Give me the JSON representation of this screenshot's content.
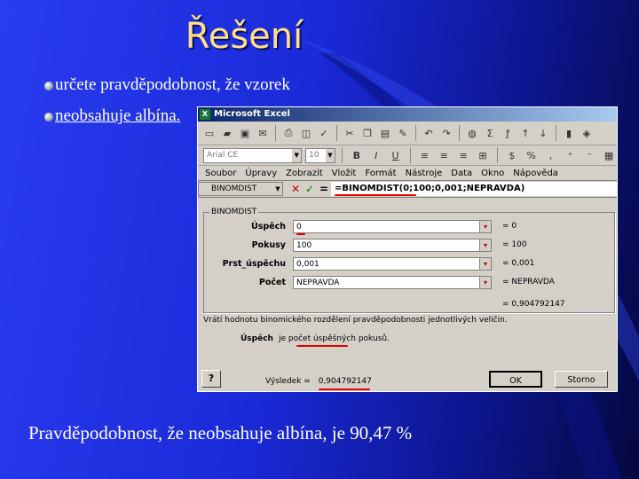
{
  "slide": {
    "title": "Řešení",
    "bullets": [
      "určete pravděpodobnost, že vzorek",
      "neobsahuje albína."
    ],
    "caption": "Pravděpodobnost, že neobsahuje albína, je 90,47 %"
  },
  "excel": {
    "window_title": "Microsoft Excel",
    "font_combo": "Arial CE",
    "size_combo": "10",
    "menu": [
      "Soubor",
      "Úpravy",
      "Zobrazit",
      "Vložit",
      "Formát",
      "Nástroje",
      "Data",
      "Okno",
      "Nápověda"
    ],
    "name_box": "BINOMDIST",
    "equals": "=",
    "formula": "=BINOMDIST(0;100;0,001;NEPRAVDA)",
    "dialog": {
      "group_title": "BINOMDIST",
      "args": [
        {
          "label": "Úspěch",
          "value": "0",
          "result": "= 0"
        },
        {
          "label": "Pokusy",
          "value": "100",
          "result": "= 100"
        },
        {
          "label": "Prst_úspěchu",
          "value": "0,001",
          "result": "= 0,001"
        },
        {
          "label": "Počet",
          "value": "NEPRAVDA",
          "result": "= NEPRAVDA"
        }
      ],
      "function_result": "= 0,904792147",
      "help_text": "Vrátí hodnotu binomického rozdělení pravděpodobnosti jednotlivých veličin.",
      "arg_name": "Úspěch",
      "arg_desc": "je počet úspěšných pokusů.",
      "help_button": "?",
      "result_label": "Výsledek =",
      "result_value": "0,904792147",
      "ok_label": "OK",
      "cancel_label": "Storno"
    }
  }
}
